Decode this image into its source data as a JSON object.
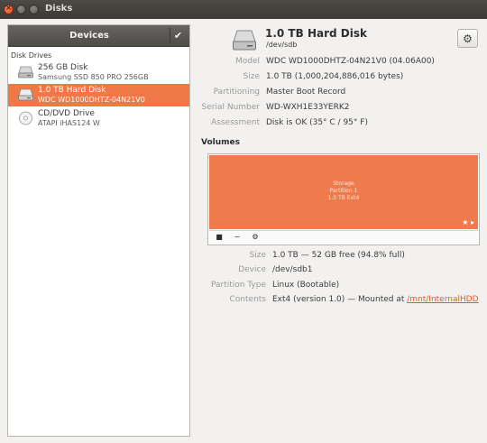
{
  "window": {
    "title": "Disks"
  },
  "sidebar": {
    "header": "Devices",
    "group_label": "Disk Drives",
    "drives": [
      {
        "name": "256 GB Disk",
        "model": "Samsung SSD 850 PRO 256GB",
        "icon": "hard-disk-icon"
      },
      {
        "name": "1.0 TB Hard Disk",
        "model": "WDC WD1000DHTZ-04N21V0",
        "icon": "hard-disk-icon",
        "selected": true
      },
      {
        "name": "CD/DVD Drive",
        "model": "ATAPI   iHAS124   W",
        "icon": "optical-drive-icon"
      }
    ]
  },
  "disk": {
    "title": "1.0 TB Hard Disk",
    "path": "/dev/sdb",
    "props": [
      {
        "label": "Model",
        "value": "WDC WD1000DHTZ-04N21V0 (04.06A00)"
      },
      {
        "label": "Size",
        "value": "1.0 TB (1,000,204,886,016 bytes)"
      },
      {
        "label": "Partitioning",
        "value": "Master Boot Record"
      },
      {
        "label": "Serial Number",
        "value": "WD-WXH1E33YERK2"
      },
      {
        "label": "Assessment",
        "value": "Disk is OK (35° C / 95° F)"
      }
    ]
  },
  "volumes": {
    "heading": "Volumes",
    "partition": {
      "line1": "Storage",
      "line2": "Partition 1",
      "line3": "1.0 TB Ext4",
      "icons": "★ ▸"
    },
    "toolbar": {
      "stop": "■",
      "delete": "−",
      "settings": "⚙"
    },
    "props": [
      {
        "label": "Size",
        "value": "1.0 TB — 52 GB free (94.8% full)"
      },
      {
        "label": "Device",
        "value": "/dev/sdb1"
      },
      {
        "label": "Partition Type",
        "value": "Linux (Bootable)"
      },
      {
        "label": "Contents",
        "value": "Ext4 (version 1.0) — Mounted at ",
        "link": "/mnt/InternalHDD"
      }
    ]
  },
  "colors": {
    "accent": "#f07746",
    "partition": "#ef7b4d",
    "titlebar": "#3c3b37"
  }
}
